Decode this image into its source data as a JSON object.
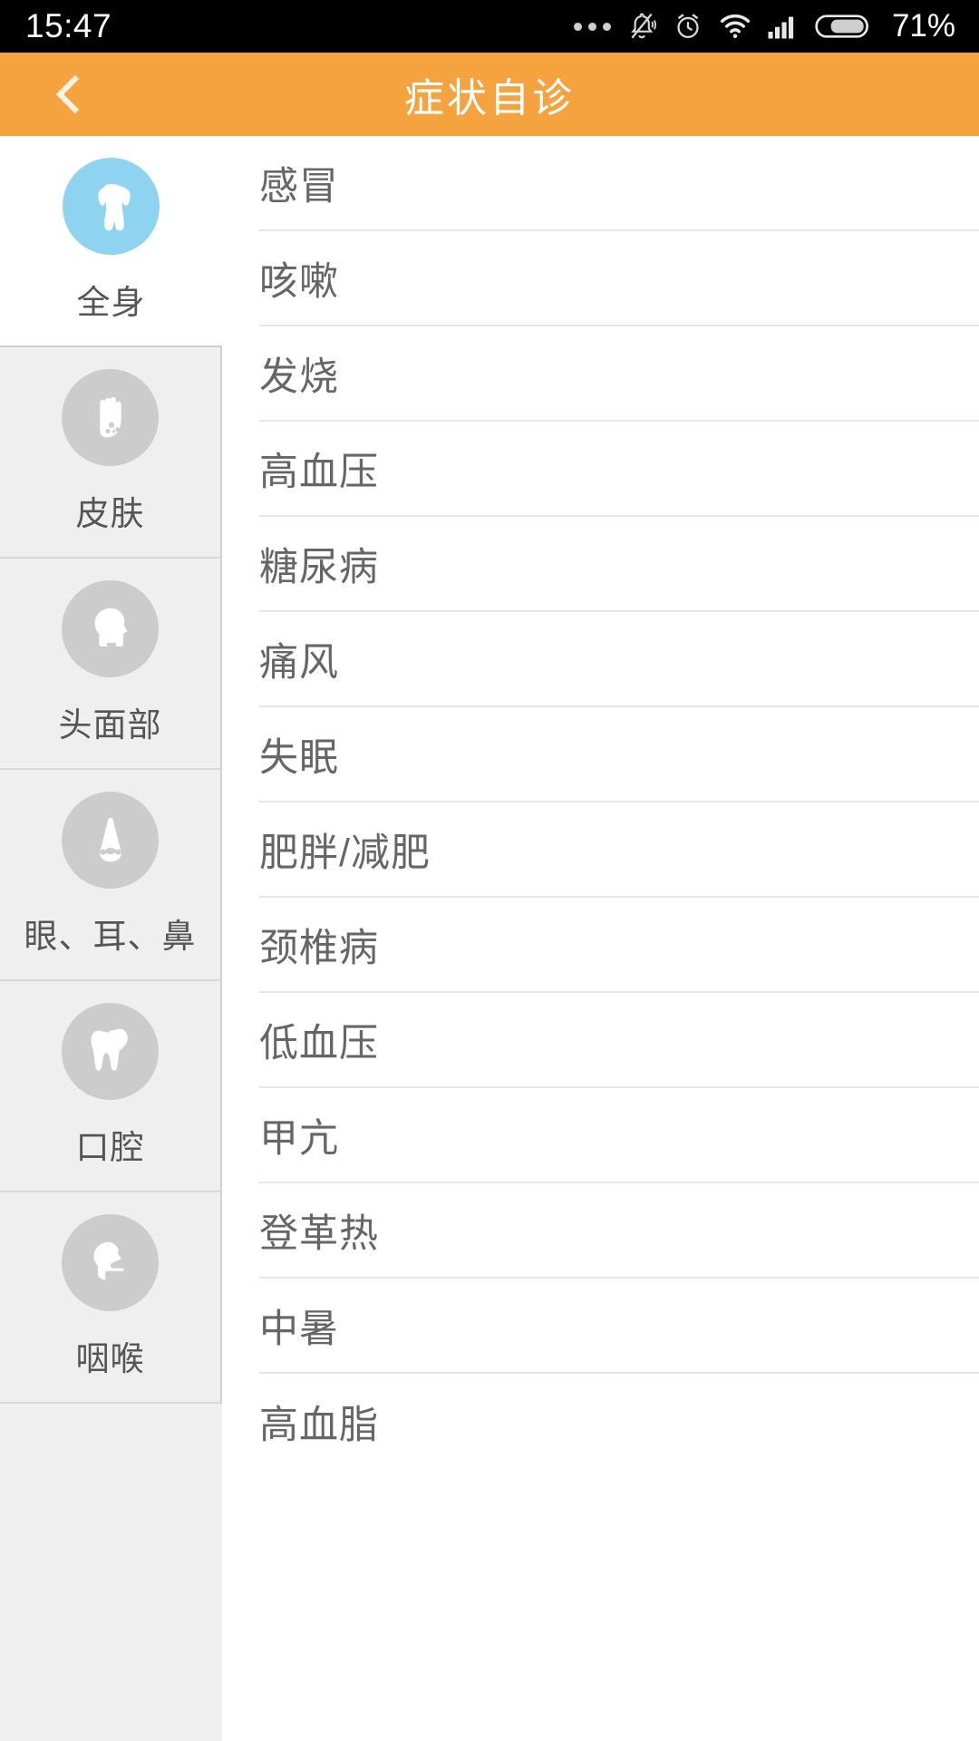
{
  "status_bar": {
    "time": "15:47",
    "battery_percent": "71%",
    "icons": [
      "more-dots-icon",
      "bell-muted-icon",
      "alarm-clock-icon",
      "wifi-icon",
      "signal-bars-icon",
      "battery-icon"
    ]
  },
  "header": {
    "title": "症状自诊",
    "back_icon": "chevron-left-icon",
    "background_color": "#f5a33f"
  },
  "sidebar": {
    "selected_index": 0,
    "active_icon_color": "#8ed3ef",
    "inactive_icon_color": "#cccccc",
    "items": [
      {
        "label": "全身",
        "icon": "torso-body-icon",
        "selected": true
      },
      {
        "label": "皮肤",
        "icon": "hand-skin-spots-icon",
        "selected": false
      },
      {
        "label": "头面部",
        "icon": "head-profile-icon",
        "selected": false
      },
      {
        "label": "眼、耳、鼻",
        "icon": "nose-icon",
        "selected": false
      },
      {
        "label": "口腔",
        "icon": "tooth-icon",
        "selected": false
      },
      {
        "label": "咽喉",
        "icon": "throat-profile-icon",
        "selected": false
      }
    ]
  },
  "list": {
    "items": [
      {
        "label": "感冒"
      },
      {
        "label": "咳嗽"
      },
      {
        "label": "发烧"
      },
      {
        "label": "高血压"
      },
      {
        "label": "糖尿病"
      },
      {
        "label": "痛风"
      },
      {
        "label": "失眠"
      },
      {
        "label": "肥胖/减肥"
      },
      {
        "label": "颈椎病"
      },
      {
        "label": "低血压"
      },
      {
        "label": "甲亢"
      },
      {
        "label": "登革热"
      },
      {
        "label": "中暑"
      },
      {
        "label": "高血脂"
      }
    ]
  }
}
